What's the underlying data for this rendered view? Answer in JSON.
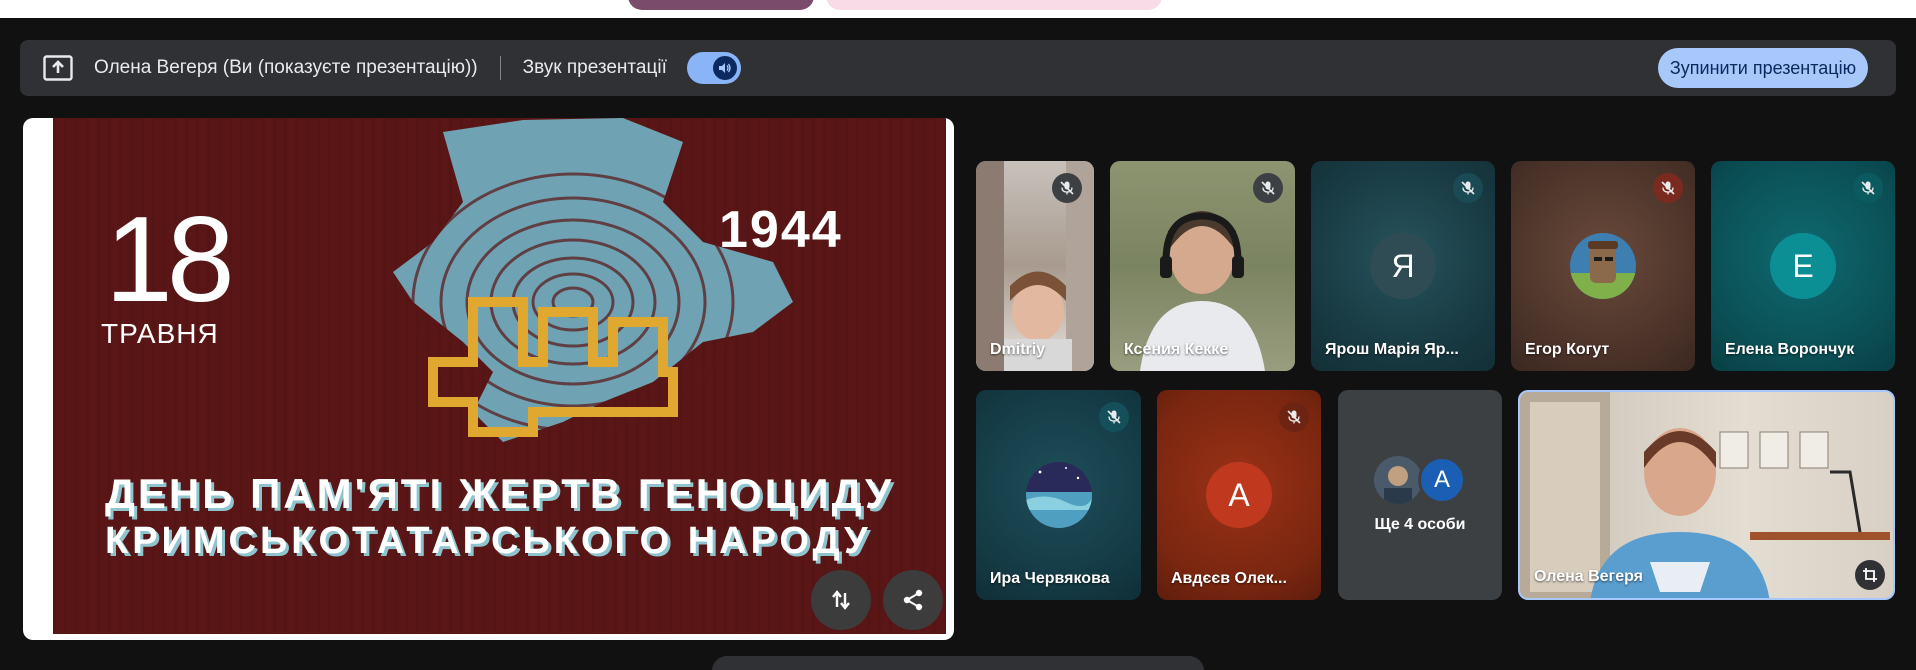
{
  "share_bar": {
    "presenter_text": "Олена Вегеря (Ви (показуєте презентацію))",
    "audio_label": "Звук презентації",
    "stop_button_label": "Зупинити презентацію",
    "share_icon": "present-to-all-icon",
    "audio_icon": "volume-up-icon"
  },
  "slide": {
    "day": "18",
    "month": "ТРАВНЯ",
    "year": "1944",
    "line1": "ДЕНЬ ПАМ'ЯТІ ЖЕРТВ ГЕНОЦИДУ",
    "line2": "КРИМСЬКОТАТАРСЬКОГО  НАРОДУ",
    "swap_icon": "swap-vert-icon",
    "share_icon": "share-icon"
  },
  "participants": [
    {
      "name": "Dmitriy",
      "muted": true,
      "type": "video"
    },
    {
      "name": "Ксения Кекке",
      "muted": true,
      "type": "video"
    },
    {
      "name": "Ярош Марія Яр...",
      "muted": true,
      "type": "initial",
      "initial": "Я",
      "color": "#1f4650"
    },
    {
      "name": "Егор Когут",
      "muted": true,
      "type": "photo"
    },
    {
      "name": "Елена Ворончук",
      "muted": true,
      "type": "initial",
      "initial": "E",
      "color": "#0b8f95"
    },
    {
      "name": "Ира Червякова",
      "muted": true,
      "type": "photo"
    },
    {
      "name": "Авдєєв Олек...",
      "muted": true,
      "type": "initial",
      "initial": "A",
      "color": "#c0391f"
    },
    {
      "name": "Ще 4 особи",
      "type": "more",
      "initial": "A"
    },
    {
      "name": "Олена Вегеря",
      "type": "self",
      "pin_icon": "crop-icon"
    }
  ],
  "colors": {
    "accent": "#8ab4f8",
    "button": "#a8c7fa",
    "bar": "#303134"
  }
}
